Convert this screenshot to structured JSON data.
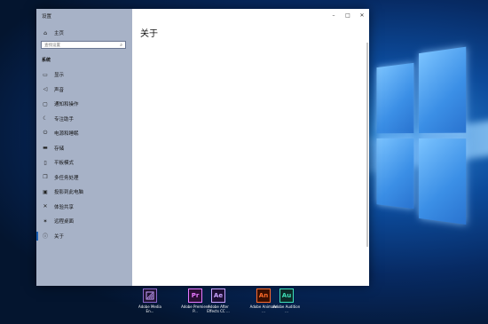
{
  "window": {
    "app_title": "设置",
    "controls": {
      "minimize": "–",
      "maximize": "□",
      "close": "✕"
    }
  },
  "sidebar": {
    "home": {
      "icon": "home-icon",
      "glyph": "⌂",
      "label": "主页"
    },
    "search": {
      "placeholder": "查找设置",
      "icon": "search-icon",
      "glyph": "⌕"
    },
    "section_title": "系统",
    "items": [
      {
        "id": "display",
        "label": "显示",
        "icon": "monitor-icon",
        "glyph": "▭"
      },
      {
        "id": "sound",
        "label": "声音",
        "icon": "speaker-icon",
        "glyph": "◁"
      },
      {
        "id": "notifications",
        "label": "通知和操作",
        "icon": "message-icon",
        "glyph": "▢"
      },
      {
        "id": "focus",
        "label": "专注助手",
        "icon": "moon-icon",
        "glyph": "☾"
      },
      {
        "id": "power",
        "label": "电源和睡眠",
        "icon": "power-icon",
        "glyph": "⏻"
      },
      {
        "id": "storage",
        "label": "存储",
        "icon": "storage-icon",
        "glyph": "▬"
      },
      {
        "id": "tablet",
        "label": "平板模式",
        "icon": "tablet-icon",
        "glyph": "▯"
      },
      {
        "id": "multitasking",
        "label": "多任务处理",
        "icon": "multitask-icon",
        "glyph": "❐"
      },
      {
        "id": "projecting",
        "label": "投影到此电脑",
        "icon": "projector-icon",
        "glyph": "▣"
      },
      {
        "id": "shared",
        "label": "体验共享",
        "icon": "share-icon",
        "glyph": "✕"
      },
      {
        "id": "remote",
        "label": "远程桌面",
        "icon": "remote-icon",
        "glyph": "✶"
      },
      {
        "id": "about",
        "label": "关于",
        "icon": "info-icon",
        "glyph": "ⓘ",
        "active": true
      }
    ]
  },
  "content": {
    "page_title": "关于"
  },
  "desktop_icons": [
    {
      "id": "media-encoder",
      "abbr": "",
      "label": "Adobe Media En...",
      "bg": "#1f1230",
      "fg": "#c9a2ff",
      "icon": "media-encoder-icon"
    },
    {
      "id": "premiere",
      "abbr": "Pr",
      "label": "Adobe Premiere P...",
      "bg": "#2a0e35",
      "fg": "#e779ff",
      "icon": "premiere-icon"
    },
    {
      "id": "after-effects",
      "abbr": "Ae",
      "label": "Adobe After Effects CC ...",
      "bg": "#1c0e35",
      "fg": "#c7a3ff",
      "icon": "after-effects-icon"
    },
    {
      "id": "animate",
      "abbr": "An",
      "label": "Adobe Animate ...",
      "bg": "#3a0e00",
      "fg": "#ff6a2a",
      "icon": "animate-icon"
    },
    {
      "id": "audition",
      "abbr": "Au",
      "label": "Adobe Audition ...",
      "bg": "#0c2a28",
      "fg": "#3fe0b8",
      "icon": "audition-icon"
    }
  ]
}
